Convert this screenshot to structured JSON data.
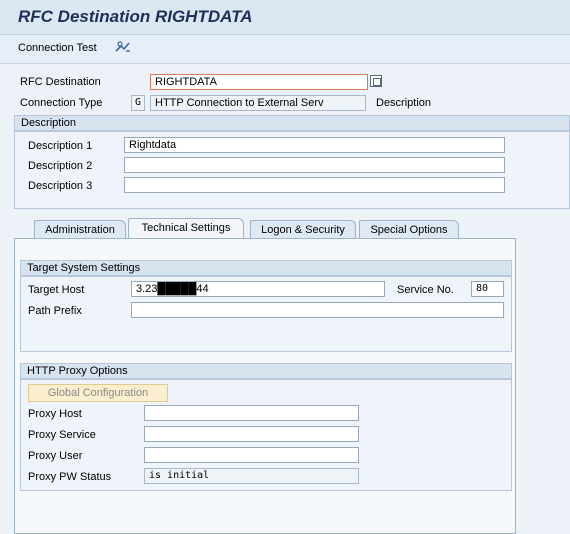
{
  "header": {
    "title": "RFC Destination RIGHTDATA"
  },
  "toolbar": {
    "connection_test_label": "Connection Test",
    "connection_test_icon": "connection-test-icon"
  },
  "top": {
    "rfc_destination_label": "RFC Destination",
    "rfc_destination_value": "RIGHTDATA",
    "connection_type_label": "Connection Type",
    "connection_type_code": "G",
    "connection_type_desc": "HTTP Connection to External Serv",
    "description_link": "Description"
  },
  "description": {
    "header": "Description",
    "rows": [
      {
        "label": "Description 1",
        "value": "Rightdata"
      },
      {
        "label": "Description 2",
        "value": ""
      },
      {
        "label": "Description 3",
        "value": ""
      }
    ]
  },
  "tabs": [
    {
      "label": "Administration"
    },
    {
      "label": "Technical Settings"
    },
    {
      "label": "Logon & Security"
    },
    {
      "label": "Special Options"
    }
  ],
  "target_system": {
    "header": "Target System Settings",
    "target_host_label": "Target Host",
    "target_host_value": "3.23█████44",
    "service_no_label": "Service No.",
    "service_no_value": "80",
    "path_prefix_label": "Path Prefix",
    "path_prefix_value": ""
  },
  "proxy": {
    "header": "HTTP Proxy Options",
    "global_config_label": "Global Configuration",
    "rows": [
      {
        "label": "Proxy Host",
        "value": ""
      },
      {
        "label": "Proxy Service",
        "value": ""
      },
      {
        "label": "Proxy User",
        "value": ""
      },
      {
        "label": "Proxy PW Status",
        "value": "is initial"
      }
    ]
  }
}
